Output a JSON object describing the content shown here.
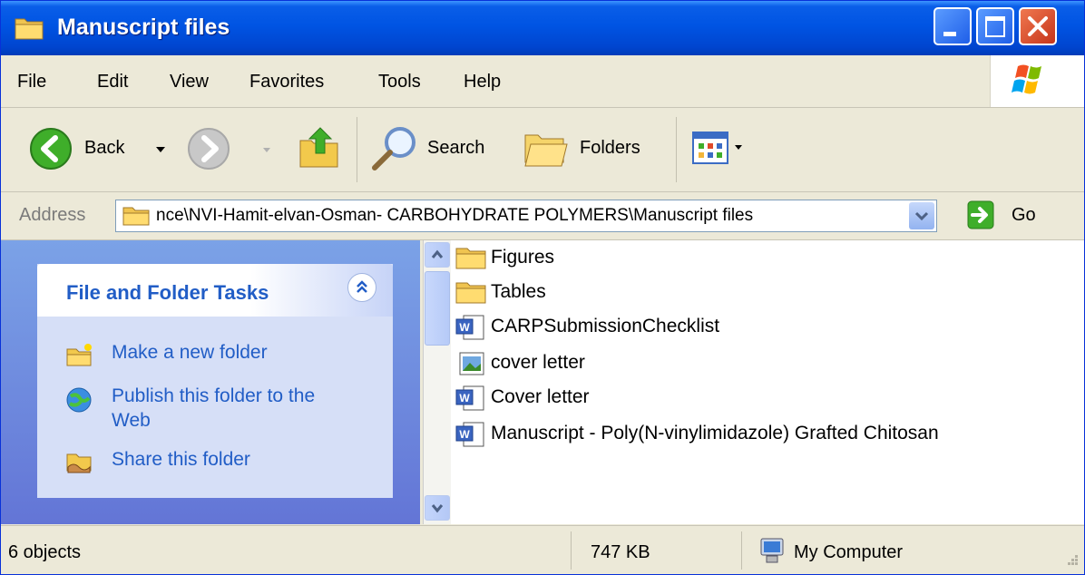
{
  "window": {
    "title": "Manuscript files"
  },
  "menu": [
    "File",
    "Edit",
    "View",
    "Favorites",
    "Tools",
    "Help"
  ],
  "toolbar": {
    "back": "Back",
    "search": "Search",
    "folders": "Folders"
  },
  "address": {
    "label": "Address",
    "value": "nce\\NVI-Hamit-elvan-Osman- CARBOHYDRATE POLYMERS\\Manuscript files",
    "go": "Go"
  },
  "tasks": {
    "title": "File and Folder Tasks",
    "items": [
      "Make a new folder",
      "Publish this folder to the Web",
      "Share this folder"
    ]
  },
  "files": [
    {
      "name": "Figures",
      "icon": "folder-icon"
    },
    {
      "name": "Tables",
      "icon": "folder-icon"
    },
    {
      "name": "CARPSubmissionChecklist",
      "icon": "word-document-icon"
    },
    {
      "name": "cover letter",
      "icon": "image-file-icon"
    },
    {
      "name": "Cover letter",
      "icon": "word-document-icon"
    },
    {
      "name": "Manuscript - Poly(N-vinylimidazole) Grafted Chitosan",
      "icon": "word-document-icon"
    }
  ],
  "status": {
    "objects": "6 objects",
    "size": "747 KB",
    "location": "My Computer"
  }
}
